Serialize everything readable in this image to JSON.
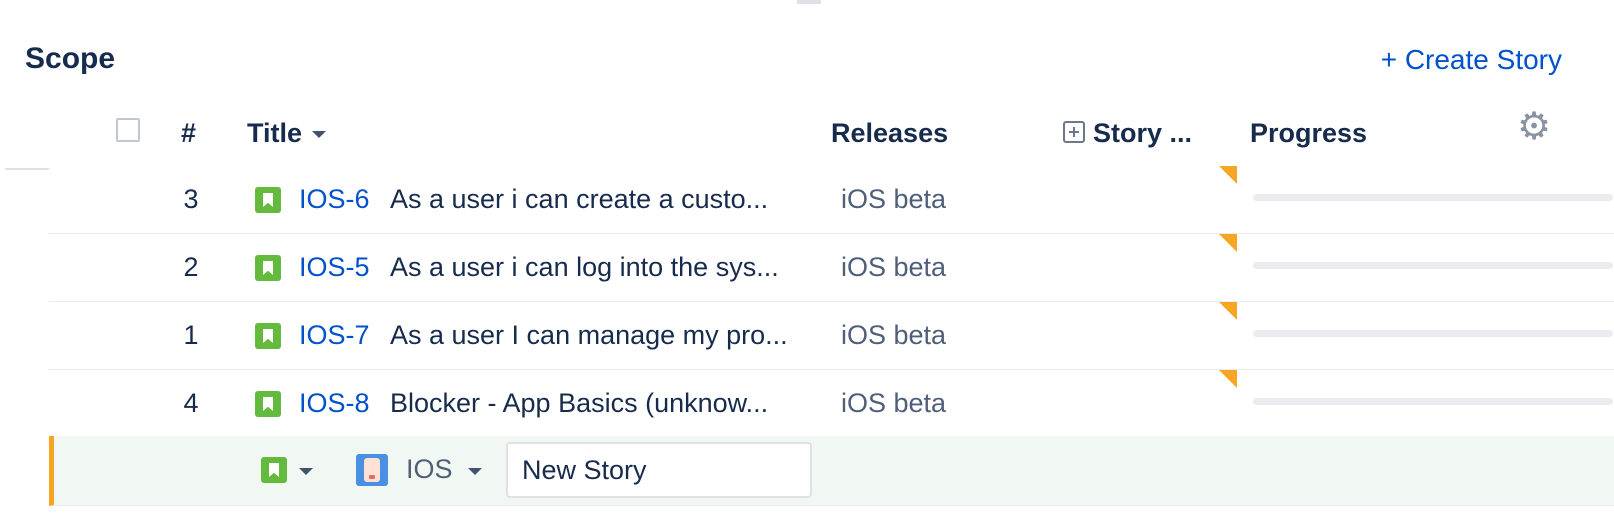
{
  "scope": {
    "title": "Scope",
    "create_story_label": "+ Create Story"
  },
  "columns": {
    "rank": "#",
    "title": "Title",
    "releases": "Releases",
    "story_points": "Story ...",
    "progress": "Progress"
  },
  "icons": {
    "select_all": "checkbox",
    "sort": "chevron-down-icon",
    "expand": "plus-square-icon",
    "settings": "gear-icon",
    "issue_type": "story-icon",
    "project": "ios-project-avatar"
  },
  "colors": {
    "link": "#0052cc",
    "story_type": "#63ba3c",
    "estimate_flag": "#f6a623",
    "create_row_bg": "#f1f8f4"
  },
  "rows": [
    {
      "rank": "3",
      "key": "IOS-6",
      "summary": "As a user i can create a custo...",
      "release": "iOS beta",
      "progress": 0
    },
    {
      "rank": "2",
      "key": "IOS-5",
      "summary": "As a user i can log into the sys...",
      "release": "iOS beta",
      "progress": 0
    },
    {
      "rank": "1",
      "key": "IOS-7",
      "summary": "As a user I can manage my pro...",
      "release": "iOS beta",
      "progress": 0
    },
    {
      "rank": "4",
      "key": "IOS-8",
      "summary": "Blocker - App Basics (unknow...",
      "release": "iOS beta",
      "progress": 0
    }
  ],
  "create_row": {
    "project": "IOS",
    "input_value": "New Story"
  }
}
